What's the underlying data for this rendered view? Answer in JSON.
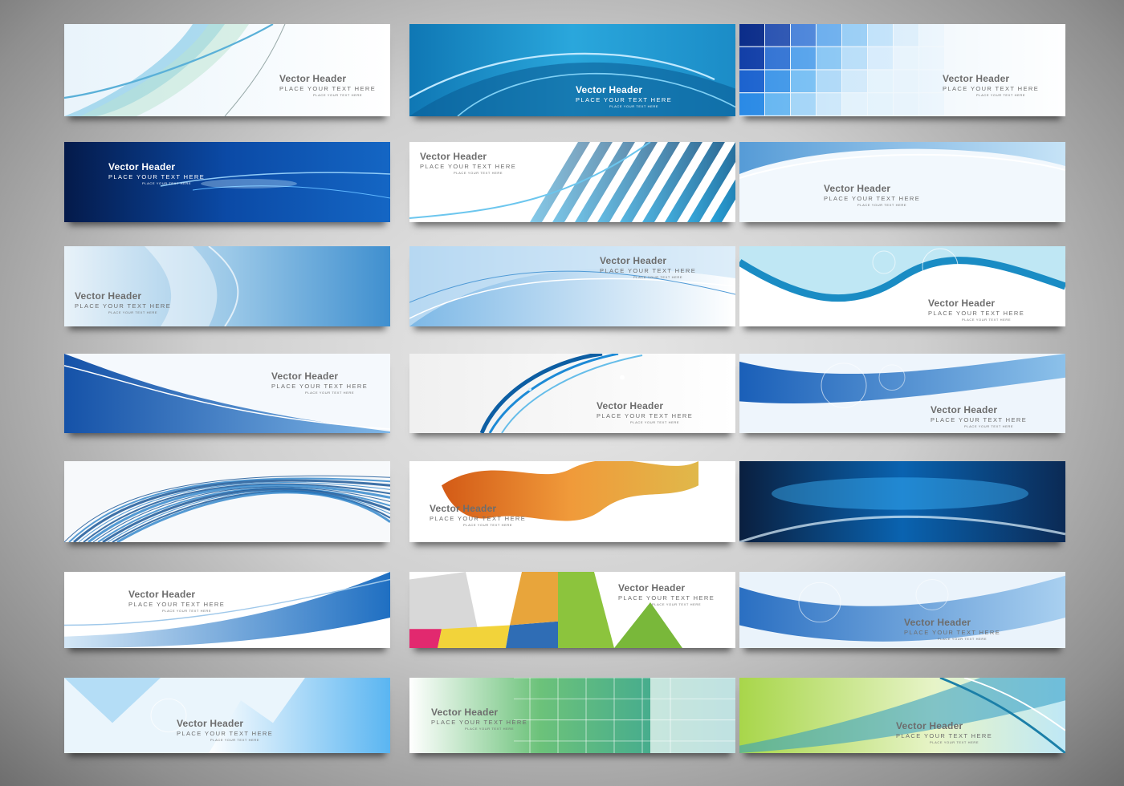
{
  "banners": [
    {
      "title": "Vector Header",
      "sub": "PLACE YOUR TEXT HERE",
      "tiny": "PLACE YOUR TEXT HERE"
    },
    {
      "title": "Vector Header",
      "sub": "PLACE YOUR TEXT HERE",
      "tiny": "PLACE YOUR TEXT HERE"
    },
    {
      "title": "Vector Header",
      "sub": "PLACE YOUR TEXT HERE",
      "tiny": "PLACE YOUR TEXT HERE"
    },
    {
      "title": "Vector Header",
      "sub": "PLACE YOUR TEXT HERE",
      "tiny": "PLACE YOUR TEXT HERE"
    },
    {
      "title": "Vector Header",
      "sub": "PLACE YOUR TEXT HERE",
      "tiny": "PLACE YOUR TEXT HERE"
    },
    {
      "title": "Vector Header",
      "sub": "PLACE YOUR TEXT HERE",
      "tiny": "PLACE YOUR TEXT HERE"
    },
    {
      "title": "Vector Header",
      "sub": "PLACE YOUR TEXT HERE",
      "tiny": "PLACE YOUR TEXT HERE"
    },
    {
      "title": "Vector Header",
      "sub": "PLACE YOUR TEXT HERE",
      "tiny": "PLACE YOUR TEXT HERE"
    },
    {
      "title": "Vector Header",
      "sub": "PLACE YOUR TEXT HERE",
      "tiny": "PLACE YOUR TEXT HERE"
    },
    {
      "title": "Vector Header",
      "sub": "PLACE YOUR TEXT HERE",
      "tiny": "PLACE YOUR TEXT HERE"
    },
    {
      "title": "Vector Header",
      "sub": "PLACE YOUR TEXT HERE",
      "tiny": "PLACE YOUR TEXT HERE"
    },
    {
      "title": "Vector Header",
      "sub": "PLACE YOUR TEXT HERE",
      "tiny": "PLACE YOUR TEXT HERE"
    },
    {
      "title": "",
      "sub": "",
      "tiny": ""
    },
    {
      "title": "Vector Header",
      "sub": "PLACE YOUR TEXT HERE",
      "tiny": "PLACE YOUR TEXT HERE"
    },
    {
      "title": "",
      "sub": "",
      "tiny": ""
    },
    {
      "title": "Vector Header",
      "sub": "PLACE YOUR TEXT HERE",
      "tiny": "PLACE YOUR TEXT HERE"
    },
    {
      "title": "Vector Header",
      "sub": "PLACE YOUR TEXT HERE",
      "tiny": "PLACE YOUR TEXT HERE"
    },
    {
      "title": "Vector Header",
      "sub": "PLACE YOUR TEXT HERE",
      "tiny": "PLACE YOUR TEXT HERE"
    },
    {
      "title": "Vector Header",
      "sub": "PLACE YOUR TEXT HERE",
      "tiny": "PLACE YOUR TEXT HERE"
    },
    {
      "title": "Vector Header",
      "sub": "PLACE YOUR TEXT HERE",
      "tiny": "PLACE YOUR TEXT HERE"
    },
    {
      "title": "Vector Header",
      "sub": "PLACE YOUR TEXT HERE",
      "tiny": "PLACE YOUR TEXT HERE"
    }
  ]
}
